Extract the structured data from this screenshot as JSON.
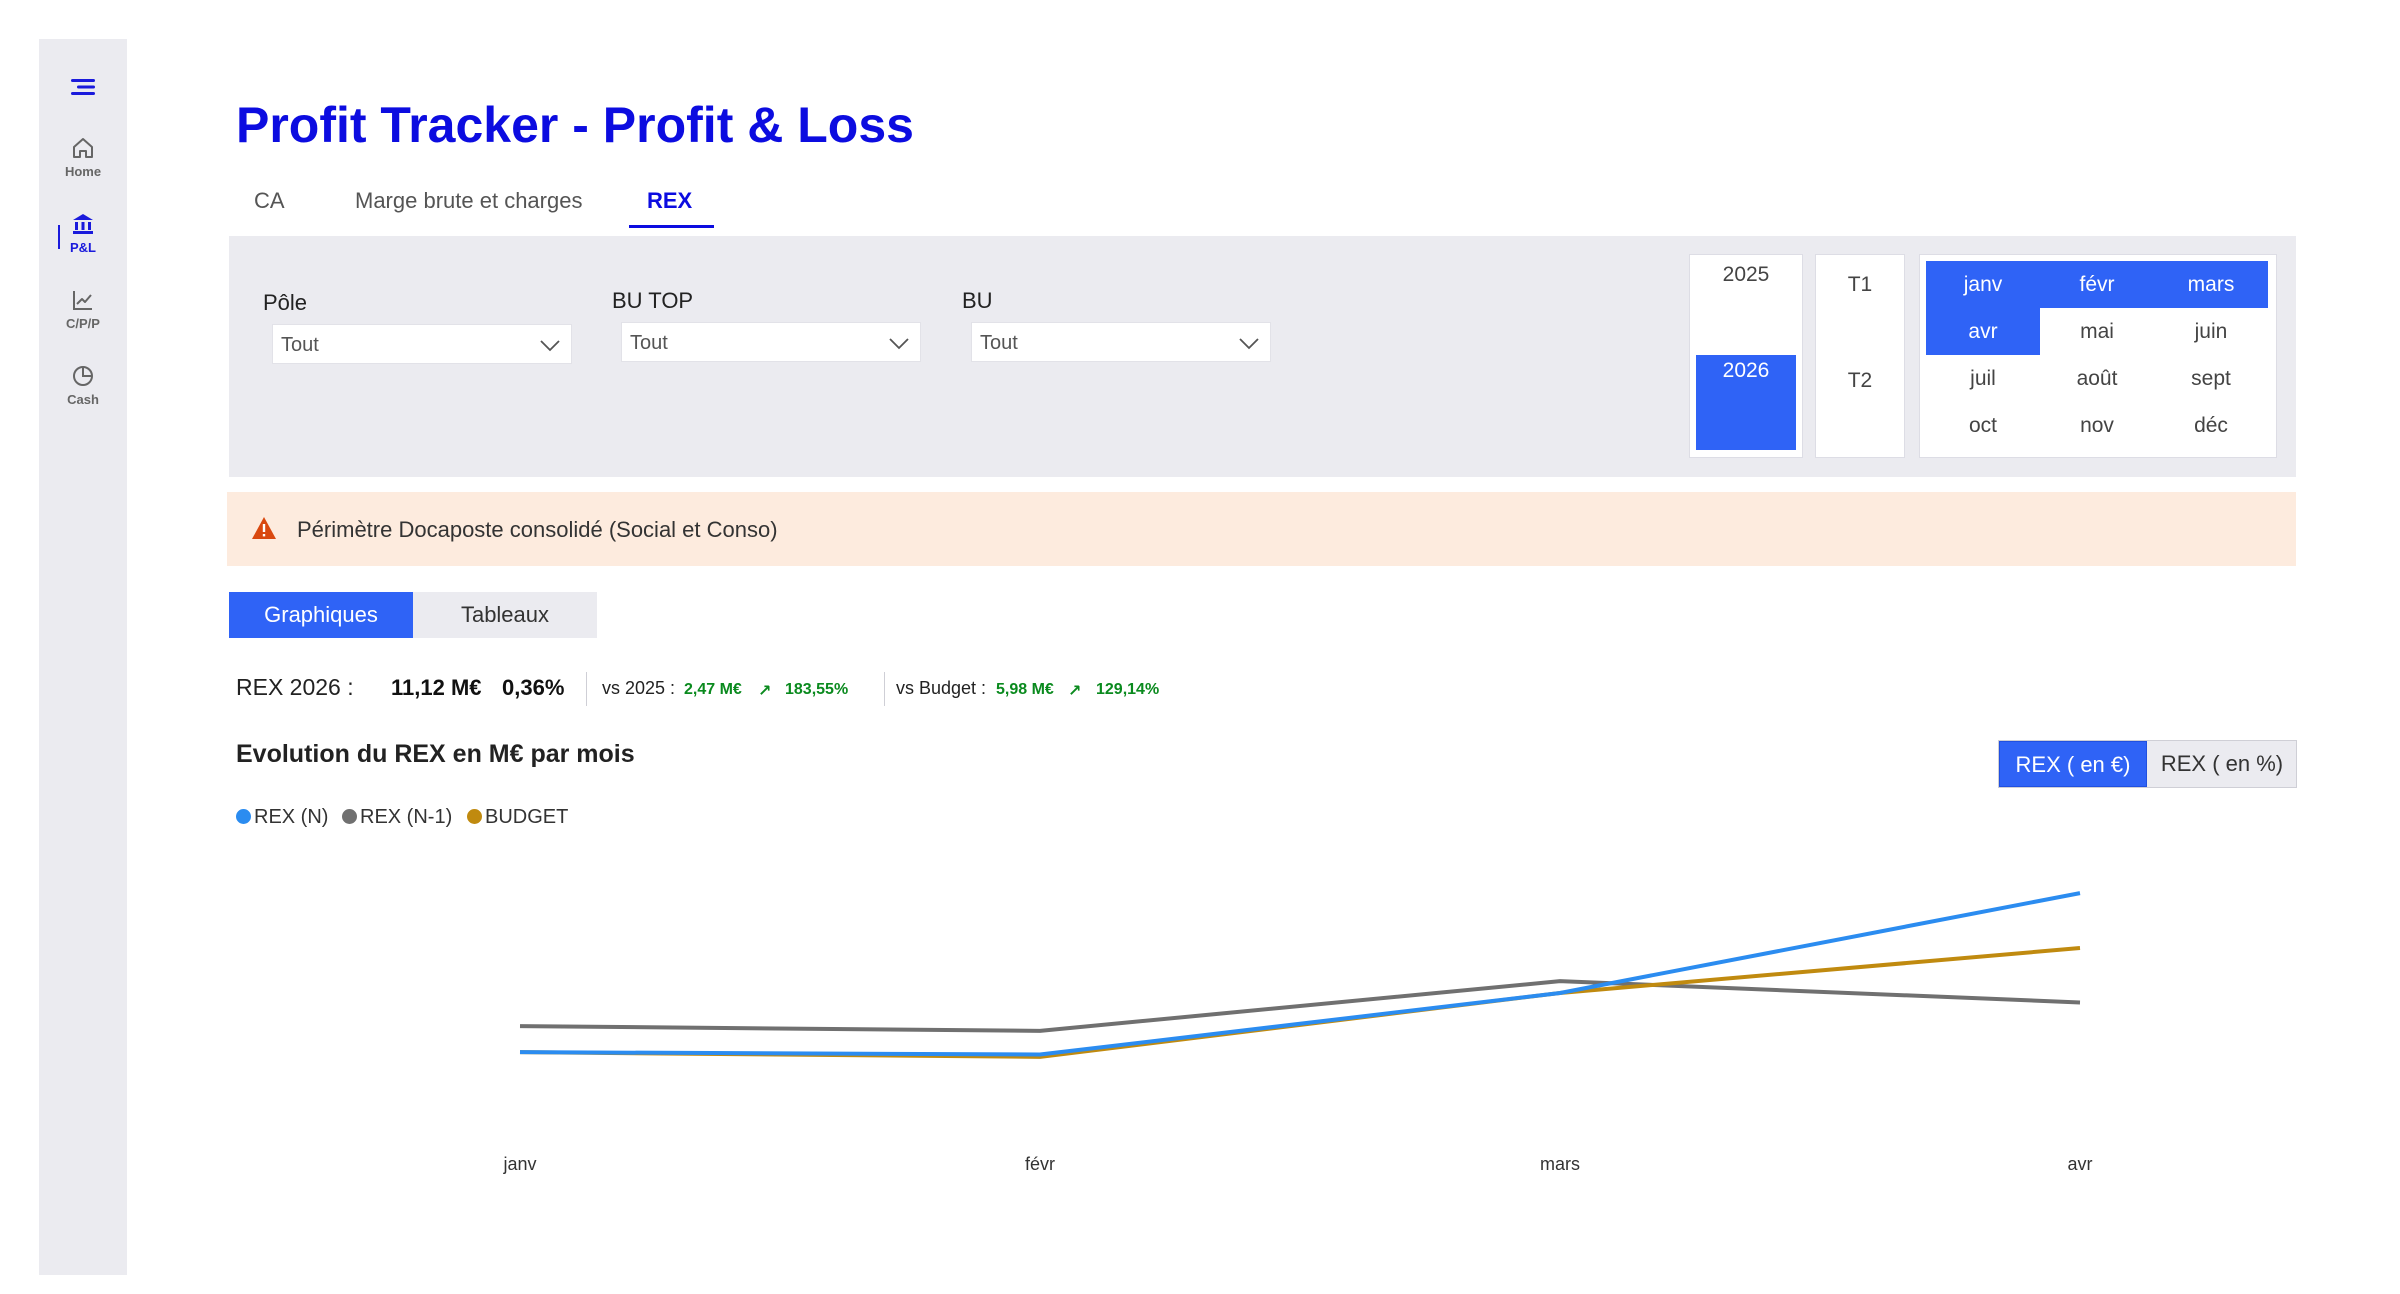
{
  "sidebar": {
    "items": [
      {
        "label": "Home",
        "icon": "home-icon"
      },
      {
        "label": "P&L",
        "icon": "bank-icon",
        "active": true
      },
      {
        "label": "C/P/P",
        "icon": "line-chart-icon"
      },
      {
        "label": "Cash",
        "icon": "pie-chart-icon"
      }
    ]
  },
  "header": {
    "title": "Profit Tracker - Profit & Loss",
    "tabs": [
      {
        "label": "CA"
      },
      {
        "label": "Marge brute et charges"
      },
      {
        "label": "REX",
        "active": true
      }
    ]
  },
  "filters": {
    "pole": {
      "label": "Pôle",
      "value": "Tout"
    },
    "bu_top": {
      "label": "BU TOP",
      "value": "Tout"
    },
    "bu": {
      "label": "BU",
      "value": "Tout"
    },
    "years": [
      {
        "label": "2025",
        "selected": false
      },
      {
        "label": "2026",
        "selected": true
      }
    ],
    "quarters": [
      "T1",
      "T2"
    ],
    "months": [
      {
        "label": "janv",
        "selected": true
      },
      {
        "label": "févr",
        "selected": true
      },
      {
        "label": "mars",
        "selected": true
      },
      {
        "label": "avr",
        "selected": true
      },
      {
        "label": "mai",
        "selected": false
      },
      {
        "label": "juin",
        "selected": false
      },
      {
        "label": "juil",
        "selected": false
      },
      {
        "label": "août",
        "selected": false
      },
      {
        "label": "sept",
        "selected": false
      },
      {
        "label": "oct",
        "selected": false
      },
      {
        "label": "nov",
        "selected": false
      },
      {
        "label": "déc",
        "selected": false
      }
    ]
  },
  "warning": {
    "text": "Périmètre Docaposte consolidé (Social et Conso)",
    "icon": "warning-icon"
  },
  "view_toggle": {
    "graphs": "Graphiques",
    "tables": "Tableaux"
  },
  "kpis": {
    "label": "REX 2026 :",
    "value": "11,12 M€",
    "percent": "0,36%",
    "vs_prev_label": "vs 2025 :",
    "vs_prev_value": "2,47 M€",
    "vs_prev_arrow": "↗",
    "vs_prev_pct": "183,55%",
    "vs_budget_label": "vs Budget :",
    "vs_budget_value": "5,98 M€",
    "vs_budget_arrow": "↗",
    "vs_budget_pct": "129,14%"
  },
  "chart_header": {
    "title": "Evolution du REX en M€ par mois",
    "switch_eur": "REX ( en €)",
    "switch_pct": "REX ( en %)"
  },
  "colors": {
    "accent": "#2f63f6",
    "title": "#0c0ce0",
    "positive": "#0a8a1e",
    "series_n": "#2b8cf0",
    "series_n1": "#707070",
    "series_budget": "#c08a0f"
  },
  "chart_data": {
    "type": "line",
    "categories": [
      "janv",
      "févr",
      "mars",
      "avr"
    ],
    "series": [
      {
        "name": "REX (N)",
        "color": "#2b8cf0",
        "values": [
          0.5,
          0.4,
          3.0,
          7.22
        ]
      },
      {
        "name": "REX (N-1)",
        "color": "#707070",
        "values": [
          1.6,
          1.4,
          3.5,
          2.6
        ]
      },
      {
        "name": "BUDGET",
        "color": "#c08a0f",
        "values": [
          0.5,
          0.3,
          3.0,
          4.9
        ]
      }
    ],
    "legend": "top-left",
    "grid": false
  }
}
